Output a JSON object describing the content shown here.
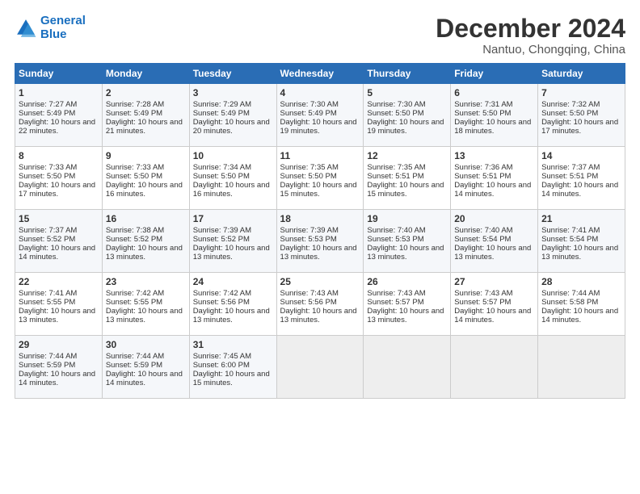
{
  "logo": {
    "line1": "General",
    "line2": "Blue"
  },
  "title": "December 2024",
  "location": "Nantuo, Chongqing, China",
  "days_of_week": [
    "Sunday",
    "Monday",
    "Tuesday",
    "Wednesday",
    "Thursday",
    "Friday",
    "Saturday"
  ],
  "weeks": [
    [
      {
        "day": "1",
        "rise": "Sunrise: 7:27 AM",
        "set": "Sunset: 5:49 PM",
        "daylight": "Daylight: 10 hours and 22 minutes."
      },
      {
        "day": "2",
        "rise": "Sunrise: 7:28 AM",
        "set": "Sunset: 5:49 PM",
        "daylight": "Daylight: 10 hours and 21 minutes."
      },
      {
        "day": "3",
        "rise": "Sunrise: 7:29 AM",
        "set": "Sunset: 5:49 PM",
        "daylight": "Daylight: 10 hours and 20 minutes."
      },
      {
        "day": "4",
        "rise": "Sunrise: 7:30 AM",
        "set": "Sunset: 5:49 PM",
        "daylight": "Daylight: 10 hours and 19 minutes."
      },
      {
        "day": "5",
        "rise": "Sunrise: 7:30 AM",
        "set": "Sunset: 5:50 PM",
        "daylight": "Daylight: 10 hours and 19 minutes."
      },
      {
        "day": "6",
        "rise": "Sunrise: 7:31 AM",
        "set": "Sunset: 5:50 PM",
        "daylight": "Daylight: 10 hours and 18 minutes."
      },
      {
        "day": "7",
        "rise": "Sunrise: 7:32 AM",
        "set": "Sunset: 5:50 PM",
        "daylight": "Daylight: 10 hours and 17 minutes."
      }
    ],
    [
      {
        "day": "8",
        "rise": "Sunrise: 7:33 AM",
        "set": "Sunset: 5:50 PM",
        "daylight": "Daylight: 10 hours and 17 minutes."
      },
      {
        "day": "9",
        "rise": "Sunrise: 7:33 AM",
        "set": "Sunset: 5:50 PM",
        "daylight": "Daylight: 10 hours and 16 minutes."
      },
      {
        "day": "10",
        "rise": "Sunrise: 7:34 AM",
        "set": "Sunset: 5:50 PM",
        "daylight": "Daylight: 10 hours and 16 minutes."
      },
      {
        "day": "11",
        "rise": "Sunrise: 7:35 AM",
        "set": "Sunset: 5:50 PM",
        "daylight": "Daylight: 10 hours and 15 minutes."
      },
      {
        "day": "12",
        "rise": "Sunrise: 7:35 AM",
        "set": "Sunset: 5:51 PM",
        "daylight": "Daylight: 10 hours and 15 minutes."
      },
      {
        "day": "13",
        "rise": "Sunrise: 7:36 AM",
        "set": "Sunset: 5:51 PM",
        "daylight": "Daylight: 10 hours and 14 minutes."
      },
      {
        "day": "14",
        "rise": "Sunrise: 7:37 AM",
        "set": "Sunset: 5:51 PM",
        "daylight": "Daylight: 10 hours and 14 minutes."
      }
    ],
    [
      {
        "day": "15",
        "rise": "Sunrise: 7:37 AM",
        "set": "Sunset: 5:52 PM",
        "daylight": "Daylight: 10 hours and 14 minutes."
      },
      {
        "day": "16",
        "rise": "Sunrise: 7:38 AM",
        "set": "Sunset: 5:52 PM",
        "daylight": "Daylight: 10 hours and 13 minutes."
      },
      {
        "day": "17",
        "rise": "Sunrise: 7:39 AM",
        "set": "Sunset: 5:52 PM",
        "daylight": "Daylight: 10 hours and 13 minutes."
      },
      {
        "day": "18",
        "rise": "Sunrise: 7:39 AM",
        "set": "Sunset: 5:53 PM",
        "daylight": "Daylight: 10 hours and 13 minutes."
      },
      {
        "day": "19",
        "rise": "Sunrise: 7:40 AM",
        "set": "Sunset: 5:53 PM",
        "daylight": "Daylight: 10 hours and 13 minutes."
      },
      {
        "day": "20",
        "rise": "Sunrise: 7:40 AM",
        "set": "Sunset: 5:54 PM",
        "daylight": "Daylight: 10 hours and 13 minutes."
      },
      {
        "day": "21",
        "rise": "Sunrise: 7:41 AM",
        "set": "Sunset: 5:54 PM",
        "daylight": "Daylight: 10 hours and 13 minutes."
      }
    ],
    [
      {
        "day": "22",
        "rise": "Sunrise: 7:41 AM",
        "set": "Sunset: 5:55 PM",
        "daylight": "Daylight: 10 hours and 13 minutes."
      },
      {
        "day": "23",
        "rise": "Sunrise: 7:42 AM",
        "set": "Sunset: 5:55 PM",
        "daylight": "Daylight: 10 hours and 13 minutes."
      },
      {
        "day": "24",
        "rise": "Sunrise: 7:42 AM",
        "set": "Sunset: 5:56 PM",
        "daylight": "Daylight: 10 hours and 13 minutes."
      },
      {
        "day": "25",
        "rise": "Sunrise: 7:43 AM",
        "set": "Sunset: 5:56 PM",
        "daylight": "Daylight: 10 hours and 13 minutes."
      },
      {
        "day": "26",
        "rise": "Sunrise: 7:43 AM",
        "set": "Sunset: 5:57 PM",
        "daylight": "Daylight: 10 hours and 13 minutes."
      },
      {
        "day": "27",
        "rise": "Sunrise: 7:43 AM",
        "set": "Sunset: 5:57 PM",
        "daylight": "Daylight: 10 hours and 14 minutes."
      },
      {
        "day": "28",
        "rise": "Sunrise: 7:44 AM",
        "set": "Sunset: 5:58 PM",
        "daylight": "Daylight: 10 hours and 14 minutes."
      }
    ],
    [
      {
        "day": "29",
        "rise": "Sunrise: 7:44 AM",
        "set": "Sunset: 5:59 PM",
        "daylight": "Daylight: 10 hours and 14 minutes."
      },
      {
        "day": "30",
        "rise": "Sunrise: 7:44 AM",
        "set": "Sunset: 5:59 PM",
        "daylight": "Daylight: 10 hours and 14 minutes."
      },
      {
        "day": "31",
        "rise": "Sunrise: 7:45 AM",
        "set": "Sunset: 6:00 PM",
        "daylight": "Daylight: 10 hours and 15 minutes."
      },
      null,
      null,
      null,
      null
    ]
  ]
}
